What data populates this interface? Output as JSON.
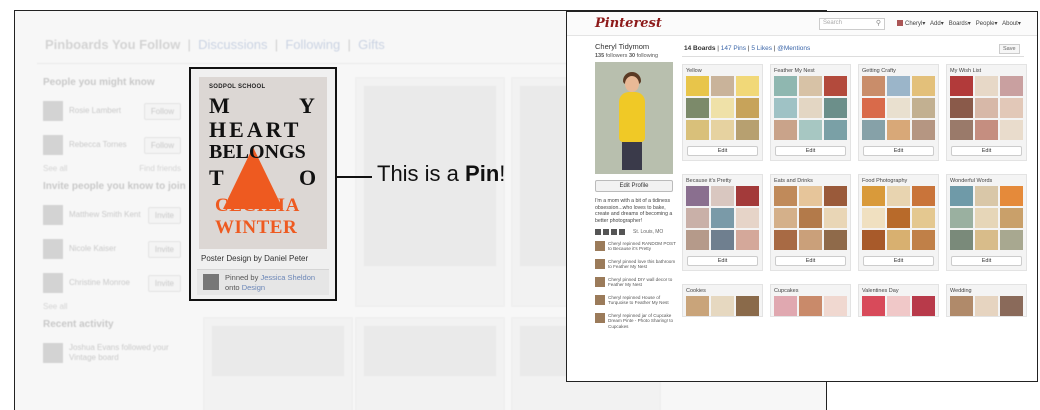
{
  "left_screenshot": {
    "nav": {
      "title": "Pinboards You Follow",
      "links": [
        "Discussions",
        "Following",
        "Gifts"
      ]
    },
    "sidebar": {
      "people_section": "People you might know",
      "people": [
        {
          "name": "Rosie Lambert",
          "button": "Follow"
        },
        {
          "name": "Rebecca Tornes",
          "button": "Follow"
        }
      ],
      "people_footer_left": "See all",
      "people_footer_right": "Find friends",
      "invite_section": "Invite people you know to join",
      "invites": [
        {
          "name": "Matthew Smith Kent",
          "button": "Invite"
        },
        {
          "name": "Nicole Kaiser",
          "button": "Invite"
        },
        {
          "name": "Christine Monroe",
          "button": "Invite"
        }
      ],
      "invite_footer": "See all",
      "recent_section": "Recent activity",
      "recent_item": "Joshua Evans followed your Vintage board"
    },
    "pin": {
      "brand": "SODPOL SCHOOL",
      "poster_lines": [
        "M",
        "Y",
        "HEART",
        "BELONGS",
        "T",
        "O",
        "CECILIA",
        "WINTER"
      ],
      "caption": "Poster Design by Daniel Peter",
      "pinned_by_prefix": "Pinned by",
      "pinned_by_user": "Jessica Sheldon",
      "onto_prefix": "onto",
      "onto_board": "Design"
    },
    "callout": {
      "prefix": "This is a ",
      "bold": "Pin",
      "suffix": "!"
    }
  },
  "pinterest": {
    "logo": "Pinterest",
    "search_placeholder": "Search",
    "menu": [
      "Cheryl",
      "Add",
      "Boards",
      "People",
      "About"
    ],
    "profile": {
      "name": "Cheryl Tidymom",
      "followers": "135",
      "followers_label": "followers",
      "following": "30",
      "following_label": "following",
      "edit_button": "Edit Profile",
      "bio": "I'm a mom with a bit of a tidiness obsession...who loves to bake, create and dreams of becoming a better photographer!",
      "location": "St. Louis, MO",
      "activity": [
        "Cheryl repinned RANDOM POST to Because it's Pretty",
        "Cheryl pinned love this bathroom to Feather My Nest",
        "Cheryl pinned DIY wall decor to Feather My Nest",
        "Cheryl repinned House of Turquoise to Feather My Nest",
        "Cheryl repinned jar of Cupcake Dream Pinte - Photo Sharing! to Cupcakes"
      ]
    },
    "stats": {
      "boards": "14 Boards",
      "pins": "147 Pins",
      "likes": "5 Likes",
      "mentions": "@Mentions"
    },
    "save_label": "Save",
    "edit_label": "Edit",
    "boards": [
      "Yellow",
      "Feather My Nest",
      "Getting Crafty",
      "My Wish List",
      "Because it's Pretty",
      "Eats and Drinks",
      "Food Photography",
      "Wonderful Words",
      "Cookies",
      "Cupcakes",
      "Valentines Day",
      "Wedding"
    ],
    "colors": {
      "accent_link": "#3b66a9",
      "logo_red": "#8d1a1a",
      "poster_orange": "#ee5a20"
    }
  }
}
